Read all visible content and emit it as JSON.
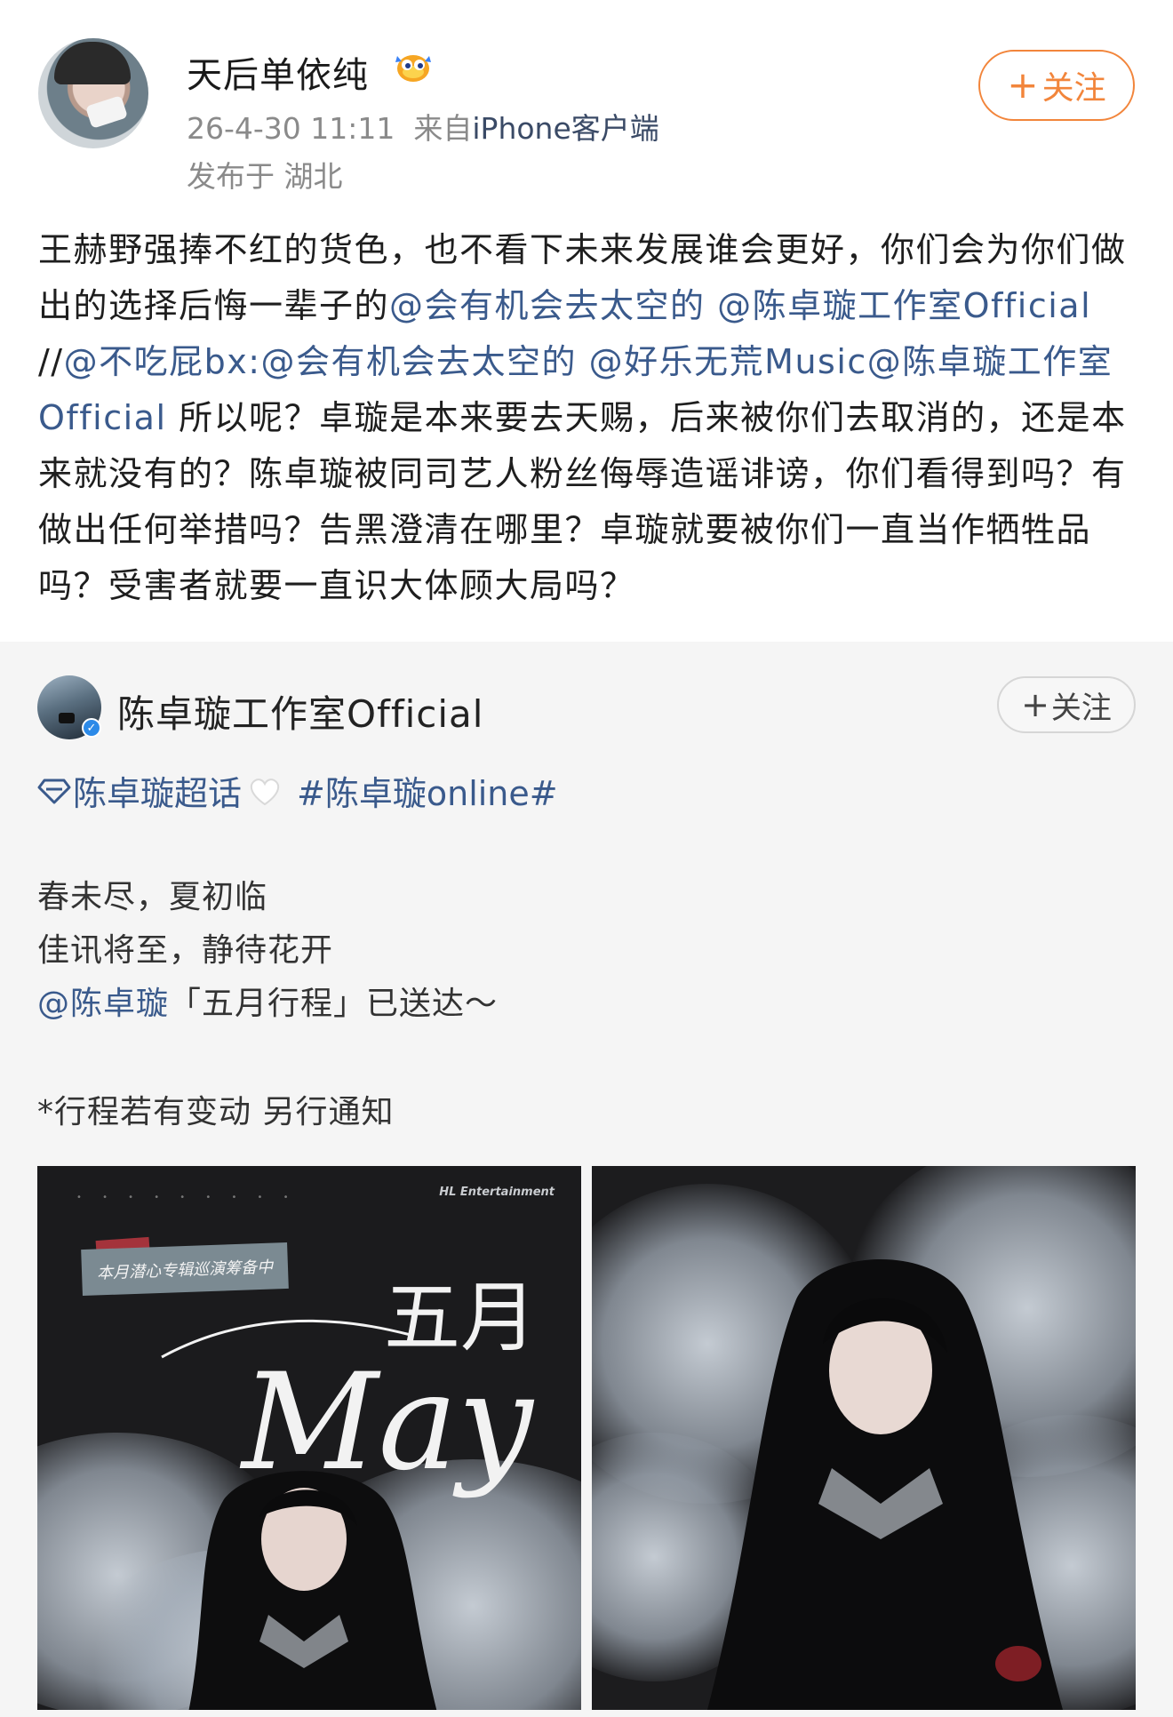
{
  "post": {
    "username": "天后单依纯",
    "time": "26-4-30 11:11",
    "source_prefix": "来自",
    "source": "iPhone客户端",
    "location": "发布于 湖北",
    "follow_plus": "+",
    "follow_label": "关注",
    "text_parts": [
      "王赫野强捧不红的货色，也不看下未来发展谁会更好，你们会为你们做出的选择后悔一辈子的",
      "@会有机会去太空的",
      " ",
      "@陈卓璇工作室Official",
      " //",
      "@不吃屁bx",
      ":",
      "@会有机会去太空的",
      " ",
      "@好乐无荒Music",
      "@陈卓璇工作室Official",
      " 所以呢？卓璇是本来要去天赐，后来被你们去取消的，还是本来就没有的？陈卓璇被同司艺人粉丝侮辱造谣诽谤，你们看得到吗？有做出任何举措吗？告黑澄清在哪里？卓璇就要被你们一直当作牺牲品吗？受害者就要一直识大体顾大局吗？"
    ]
  },
  "repost": {
    "name": "陈卓璇工作室Official",
    "follow_plus": "+",
    "follow_label": "关注",
    "supertopic": "陈卓璇超话",
    "hashtag": "#陈卓璇online#",
    "lines": [
      "春未尽，夏初临",
      "佳讯将至，静待花开"
    ],
    "mention": "@陈卓璇",
    "mention_tail": "「五月行程」已送达～",
    "note": "*行程若有变动 另行通知",
    "photo1": {
      "brand": "HL Entertainment",
      "tag": "本月潜心专辑巡演筹备中",
      "title_en": "May",
      "title_cn": "五月"
    }
  },
  "colors": {
    "link": "#3a5a8c",
    "follow_orange": "#f2853b",
    "repost_bg": "#f5f5f5",
    "meta_gray": "#8a8a8a"
  }
}
